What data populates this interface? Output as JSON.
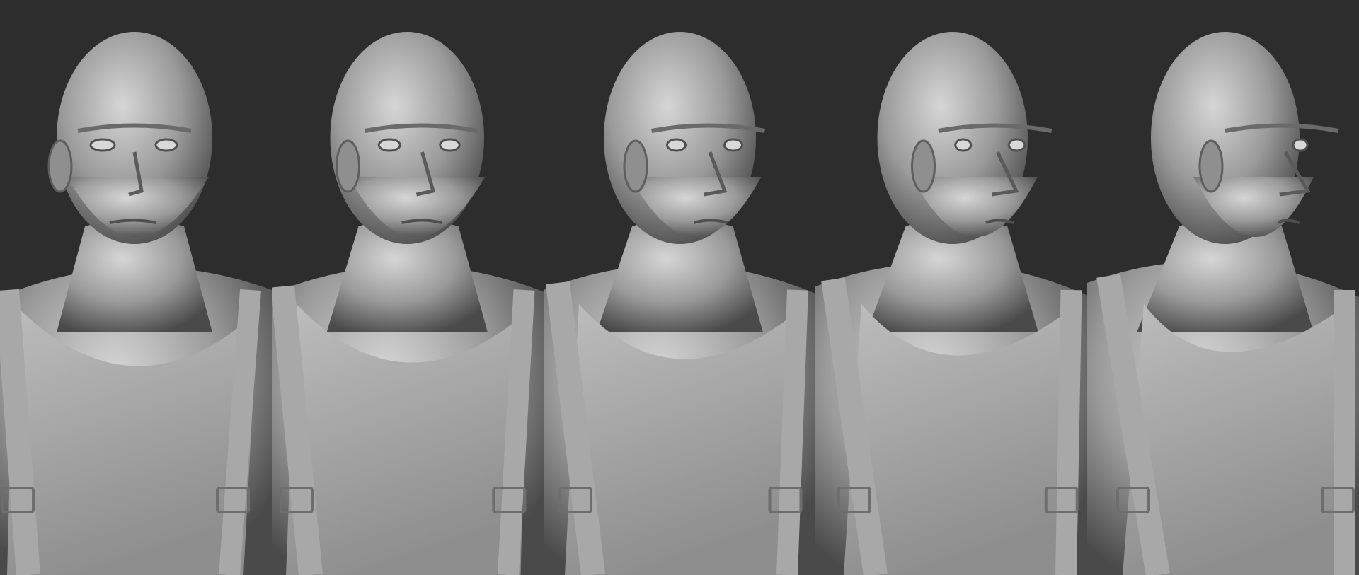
{
  "image": {
    "subject": "",
    "views": [
      {
        "view": "front"
      },
      {
        "view": "three-quarter-right-slight"
      },
      {
        "view": "three-quarter-right"
      },
      {
        "view": "profile-right-near"
      },
      {
        "view": "profile-right"
      }
    ],
    "colors": {
      "background": "#2d2d2d",
      "clay_light": "#c9c9c9",
      "clay_mid": "#9a9a9a",
      "clay_dark": "#4a4a4a"
    }
  }
}
